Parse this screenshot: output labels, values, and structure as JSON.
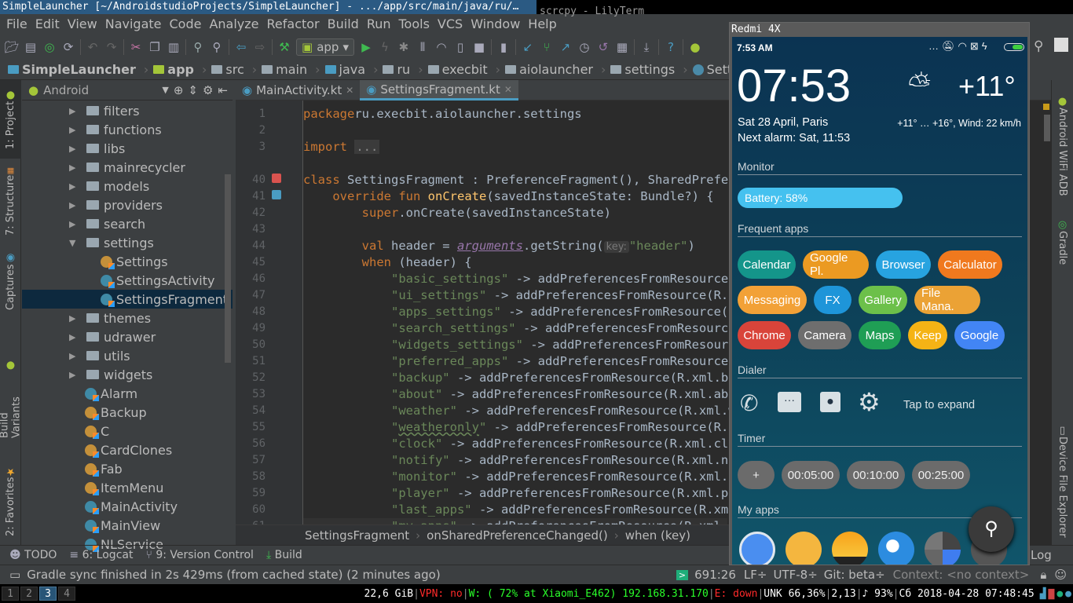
{
  "window": {
    "title_active": "SimpleLauncher [~/AndroidstudioProjects/SimpleLauncher] - .../app/src/main/java/ru/…",
    "title_inactive": "scrcpy - LilyTerm"
  },
  "menu": [
    "File",
    "Edit",
    "View",
    "Navigate",
    "Code",
    "Analyze",
    "Refactor",
    "Build",
    "Run",
    "Tools",
    "VCS",
    "Window",
    "Help"
  ],
  "toolbar": {
    "icons": [
      "open-icon",
      "save-icon",
      "sync-icon",
      "synchronize-icon",
      "undo-icon",
      "redo-icon",
      "cut-icon",
      "copy-icon",
      "paste-icon",
      "find-icon",
      "replace-icon",
      "back-icon",
      "forward-icon",
      "make-icon"
    ],
    "config": "app",
    "icons2": [
      "run-icon",
      "apply-changes-icon",
      "debug-icon",
      "attach-icon",
      "profile-icon",
      "coverage-icon",
      "stop-icon",
      "avd-icon",
      "vcs-update-icon",
      "vcs-commit-icon",
      "vcs-push-icon",
      "vcs-history-icon",
      "vcs-revert-icon",
      "project-structure-icon",
      "sdk-manager-icon",
      "help-icon",
      "android-icon"
    ]
  },
  "breadcrumb": [
    "SimpleLauncher",
    "app",
    "src",
    "main",
    "java",
    "ru",
    "execbit",
    "aiolauncher",
    "settings",
    "SettingsFragment.kt"
  ],
  "left_strip": {
    "project": "1: Project",
    "structure": "7: Structure",
    "captures": "Captures",
    "build_variants": "Build Variants",
    "favorites": "2: Favorites"
  },
  "project": {
    "view": "Android",
    "tree": [
      {
        "label": "filters",
        "type": "folder"
      },
      {
        "label": "functions",
        "type": "folder"
      },
      {
        "label": "libs",
        "type": "folder"
      },
      {
        "label": "mainrecycler",
        "type": "folder"
      },
      {
        "label": "models",
        "type": "folder"
      },
      {
        "label": "providers",
        "type": "folder"
      },
      {
        "label": "search",
        "type": "folder"
      },
      {
        "label": "settings",
        "type": "folder-open"
      },
      {
        "label": "Settings",
        "type": "object",
        "indent": 1
      },
      {
        "label": "SettingsActivity",
        "type": "class",
        "indent": 1
      },
      {
        "label": "SettingsFragment",
        "type": "class",
        "indent": 1,
        "selected": true
      },
      {
        "label": "themes",
        "type": "folder"
      },
      {
        "label": "udrawer",
        "type": "folder"
      },
      {
        "label": "utils",
        "type": "folder"
      },
      {
        "label": "widgets",
        "type": "folder"
      },
      {
        "label": "Alarm",
        "type": "class"
      },
      {
        "label": "Backup",
        "type": "object"
      },
      {
        "label": "C",
        "type": "object"
      },
      {
        "label": "CardClones",
        "type": "object"
      },
      {
        "label": "Fab",
        "type": "object"
      },
      {
        "label": "ItemMenu",
        "type": "object"
      },
      {
        "label": "MainActivity",
        "type": "class"
      },
      {
        "label": "MainView",
        "type": "class"
      },
      {
        "label": "NLService",
        "type": "class"
      }
    ]
  },
  "editor": {
    "tabs": [
      {
        "label": "MainActivity.kt",
        "active": false
      },
      {
        "label": "SettingsFragment.kt",
        "active": true
      }
    ],
    "lines": [
      {
        "n": "1",
        "t": [
          [
            "kw",
            "package"
          ],
          [
            "",
            "ru.execbit.aiolauncher.settings"
          ]
        ]
      },
      {
        "n": "2",
        "t": []
      },
      {
        "n": "3",
        "t": [
          [
            "kw",
            "import"
          ],
          [
            "",
            " "
          ],
          [
            "foldc",
            "..."
          ]
        ]
      },
      {
        "n": "",
        "t": []
      },
      {
        "n": "40",
        "t": [
          [
            "kw",
            "class"
          ],
          [
            "",
            " SettingsFragment : PreferenceFragment(), SharedPreferences.OnSharedPreferenceChangeListener {"
          ]
        ]
      },
      {
        "n": "41",
        "t": [
          [
            "",
            "    "
          ],
          [
            "kw",
            "override fun "
          ],
          [
            "fn",
            "onCreate"
          ],
          [
            "",
            "(savedInstanceState: Bundle?) {"
          ]
        ]
      },
      {
        "n": "42",
        "t": [
          [
            "",
            "        "
          ],
          [
            "kw",
            "super"
          ],
          [
            "",
            ".onCreate(savedInstanceState)"
          ]
        ]
      },
      {
        "n": "43",
        "t": []
      },
      {
        "n": "44",
        "t": [
          [
            "",
            "        "
          ],
          [
            "kw",
            "val"
          ],
          [
            "",
            " header = "
          ],
          [
            "prop",
            "arguments"
          ],
          [
            "",
            ".getString("
          ],
          [
            "hint",
            "key:"
          ],
          [
            "str",
            "\"header\""
          ],
          [
            "",
            ")"
          ]
        ]
      },
      {
        "n": "45",
        "t": [
          [
            "",
            "        "
          ],
          [
            "kw",
            "when"
          ],
          [
            "",
            " (header) {"
          ]
        ]
      },
      {
        "n": "46",
        "t": [
          [
            "",
            "            "
          ],
          [
            "str",
            "\"basic_settings\""
          ],
          [
            "",
            " -> addPreferencesFromResource(R.xml.basic_settings)"
          ]
        ]
      },
      {
        "n": "47",
        "t": [
          [
            "",
            "            "
          ],
          [
            "str",
            "\"ui_settings\""
          ],
          [
            "",
            " -> addPreferencesFromResource(R.xml.ui_settings)"
          ]
        ]
      },
      {
        "n": "48",
        "t": [
          [
            "",
            "            "
          ],
          [
            "str",
            "\"apps_settings\""
          ],
          [
            "",
            " -> addPreferencesFromResource(R.xml.apps_settings)"
          ]
        ]
      },
      {
        "n": "49",
        "t": [
          [
            "",
            "            "
          ],
          [
            "str",
            "\"search_settings\""
          ],
          [
            "",
            " -> addPreferencesFromResource(R.xml.search_settings)"
          ]
        ]
      },
      {
        "n": "50",
        "t": [
          [
            "",
            "            "
          ],
          [
            "str",
            "\"widgets_settings\""
          ],
          [
            "",
            " -> addPreferencesFromResource(R.xml.widgets_settings)"
          ]
        ]
      },
      {
        "n": "51",
        "t": [
          [
            "",
            "            "
          ],
          [
            "str",
            "\"preferred_apps\""
          ],
          [
            "",
            " -> addPreferencesFromResource(R.xml.preferred_apps)"
          ]
        ]
      },
      {
        "n": "52",
        "t": [
          [
            "",
            "            "
          ],
          [
            "str",
            "\"backup\""
          ],
          [
            "",
            " -> addPreferencesFromResource(R.xml.backup)"
          ]
        ]
      },
      {
        "n": "53",
        "t": [
          [
            "",
            "            "
          ],
          [
            "str",
            "\"about\""
          ],
          [
            "",
            " -> addPreferencesFromResource(R.xml.about)"
          ]
        ]
      },
      {
        "n": "54",
        "t": [
          [
            "",
            "            "
          ],
          [
            "str",
            "\"weather\""
          ],
          [
            "",
            " -> addPreferencesFromResource(R.xml.weather)"
          ]
        ]
      },
      {
        "n": "55",
        "t": [
          [
            "",
            "            "
          ],
          [
            "str",
            "\""
          ],
          [
            "str wavy",
            "weatheronly"
          ],
          [
            "str",
            "\""
          ],
          [
            "",
            " -> addPreferencesFromResource(R.xml.weatheronly)"
          ]
        ]
      },
      {
        "n": "56",
        "t": [
          [
            "",
            "            "
          ],
          [
            "str",
            "\"clock\""
          ],
          [
            "",
            " -> addPreferencesFromResource(R.xml.clock)"
          ]
        ]
      },
      {
        "n": "57",
        "t": [
          [
            "",
            "            "
          ],
          [
            "str",
            "\"notify\""
          ],
          [
            "",
            " -> addPreferencesFromResource(R.xml.notify)"
          ]
        ]
      },
      {
        "n": "58",
        "t": [
          [
            "",
            "            "
          ],
          [
            "str",
            "\"monitor\""
          ],
          [
            "",
            " -> addPreferencesFromResource(R.xml.monitor)"
          ]
        ]
      },
      {
        "n": "59",
        "t": [
          [
            "",
            "            "
          ],
          [
            "str",
            "\"player\""
          ],
          [
            "",
            " -> addPreferencesFromResource(R.xml.player)"
          ]
        ]
      },
      {
        "n": "60",
        "t": [
          [
            "",
            "            "
          ],
          [
            "str",
            "\"last_apps\""
          ],
          [
            "",
            " -> addPreferencesFromResource(R.xml.last_apps)"
          ]
        ]
      },
      {
        "n": "61",
        "t": [
          [
            "",
            "            "
          ],
          [
            "str",
            "\"my_apps\""
          ],
          [
            "",
            " -> addPreferencesFromResource(R.xml.my_apps)"
          ]
        ],
        "current": true
      }
    ],
    "crumbs": [
      "SettingsFragment",
      "onSharedPreferenceChanged()",
      "when (key)"
    ]
  },
  "right_strip": {
    "wifi_adb": "Android WiFi ADB",
    "gradle": "Gradle",
    "device_explorer": "Device File Explorer",
    "event_log": "Log"
  },
  "tool_windows": [
    {
      "label": "TODO",
      "icon": "todo-icon"
    },
    {
      "label": "6: Logcat",
      "icon": "logcat-icon"
    },
    {
      "label": "9: Version Control",
      "icon": "vcs-icon"
    },
    {
      "label": "Build",
      "icon": "build-icon"
    }
  ],
  "status": {
    "message": "Gradle sync finished in 2s 429ms (from cached state) (2 minutes ago)",
    "position": "691:26",
    "line_sep": "LF÷",
    "encoding": "UTF-8÷",
    "git": "Git: beta÷",
    "context": "Context: <no context>"
  },
  "i3bar": {
    "workspaces": [
      {
        "n": "1"
      },
      {
        "n": "2"
      },
      {
        "n": "3",
        "active": true
      },
      {
        "n": "4"
      }
    ],
    "segments": [
      {
        "text": "22,6 GiB",
        "color": "#ffffff"
      },
      {
        "text": "|",
        "color": "#888888"
      },
      {
        "text": "VPN: no",
        "color": "#ff2a2a"
      },
      {
        "text": "|",
        "color": "#888888"
      },
      {
        "text": "W: ( 72% at Xiaomi_E462) 192.168.31.170",
        "color": "#2aff2a"
      },
      {
        "text": "|",
        "color": "#888888"
      },
      {
        "text": "E: down",
        "color": "#ff2a2a"
      },
      {
        "text": "|",
        "color": "#888888"
      },
      {
        "text": "UNK 66,36%",
        "color": "#ffffff"
      },
      {
        "text": "|",
        "color": "#888888"
      },
      {
        "text": "2,13",
        "color": "#ffffff"
      },
      {
        "text": "|",
        "color": "#888888"
      },
      {
        "text": "♪ 93%",
        "color": "#ffffff"
      },
      {
        "text": "|",
        "color": "#888888"
      },
      {
        "text": "Сб 2018-04-28 07:48:45",
        "color": "#ffffff"
      }
    ]
  },
  "phone": {
    "window_title": "Redmi 4X",
    "status_time": "7:53 AM",
    "clock": "07:53",
    "date": "Sat 28 April, Paris",
    "alarm": "Next alarm: Sat, 11:53",
    "temp": "+11°",
    "forecast": "+11° … +16°, Wind: 22 km/h",
    "monitor": {
      "title": "Monitor",
      "battery_label": "Battery: 58%",
      "battery_percent": 58
    },
    "frequent": {
      "title": "Frequent apps",
      "apps": [
        {
          "label": "Calendar",
          "color": "#14958a"
        },
        {
          "label": "Google Pl.",
          "color": "#eb9a22"
        },
        {
          "label": "Browser",
          "color": "#27a3e0"
        },
        {
          "label": "Calculator",
          "color": "#f0791e"
        },
        {
          "label": "Messaging",
          "color": "#f2a137"
        },
        {
          "label": "FX",
          "color": "#1e95d9"
        },
        {
          "label": "Gallery",
          "color": "#6cc04a"
        },
        {
          "label": "File Mana.",
          "color": "#eba235"
        },
        {
          "label": "Chrome",
          "color": "#d9443a"
        },
        {
          "label": "Camera",
          "color": "#6e6e6e"
        },
        {
          "label": "Maps",
          "color": "#1f9e55"
        },
        {
          "label": "Keep",
          "color": "#f5b315"
        },
        {
          "label": "Google",
          "color": "#4285f4"
        }
      ]
    },
    "dialer": {
      "title": "Dialer",
      "icons": [
        "phone-icon",
        "message-icon",
        "contacts-icon",
        "settings-icon"
      ],
      "expand": "Tap to expand"
    },
    "timer": {
      "title": "Timer",
      "buttons": [
        "+",
        "00:05:00",
        "00:10:00",
        "00:25:00"
      ]
    },
    "myapps": {
      "title": "My apps",
      "icons": [
        "clock-app-icon",
        "notes-app-icon",
        "photos-app-icon",
        "browser-app-icon",
        "calculator-app-icon",
        "downloads-app-icon"
      ]
    }
  }
}
